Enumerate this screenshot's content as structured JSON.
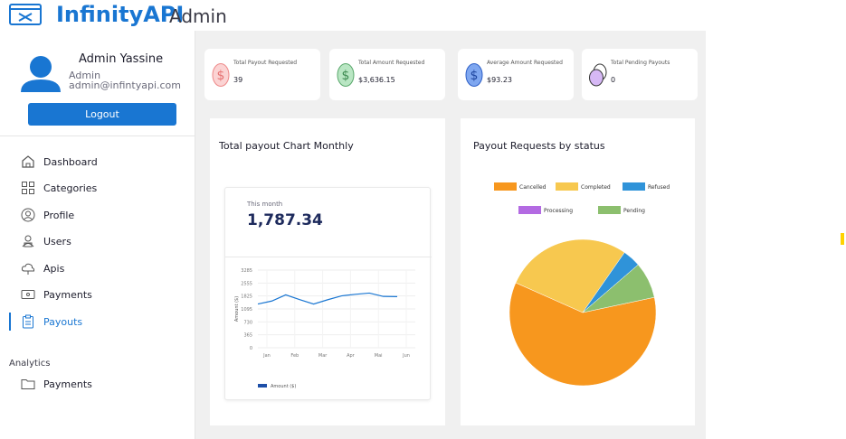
{
  "header": {
    "brand": "InfinityAPI",
    "subtitle": "Admin",
    "brand_color": "#1976d2"
  },
  "profile": {
    "name": "Admin  Yassine",
    "role": "Admin",
    "email": "admin@infintyapi.com",
    "logout_label": "Logout"
  },
  "sidebar": {
    "items": [
      {
        "label": "Dashboard",
        "icon": "home-icon"
      },
      {
        "label": "Categories",
        "icon": "grid-icon"
      },
      {
        "label": "Profile",
        "icon": "person-icon"
      },
      {
        "label": "Users",
        "icon": "users-icon"
      },
      {
        "label": "Apis",
        "icon": "cloud-icon"
      },
      {
        "label": "Payments",
        "icon": "payment-icon"
      },
      {
        "label": "Payouts",
        "icon": "clipboard-icon",
        "active": true
      }
    ],
    "analytics_label": "Analytics",
    "analytics_items": [
      {
        "label": "Payments",
        "icon": "folder-icon"
      }
    ]
  },
  "stats": [
    {
      "label": "Total Payout Requested",
      "value": "39",
      "icon": "dollar-coin-icon",
      "color": "#f4a6a6"
    },
    {
      "label": "Total Amount Requested",
      "value": "$3,636.15",
      "icon": "dollar-coin-icon",
      "color": "#8fd19e"
    },
    {
      "label": "Average Amount Requested",
      "value": "$93.23",
      "icon": "dollar-coin-icon",
      "color": "#5a8bea"
    },
    {
      "label": "Total Pending Payouts",
      "value": "0",
      "icon": "coins-icon",
      "color": "#c9a7f0"
    }
  ],
  "line_panel": {
    "title": "Total payout Chart Monthly",
    "this_month_label": "This month",
    "this_month_value": "1,787.34"
  },
  "pie_panel": {
    "title": "Payout Requests by status"
  },
  "chart_data": [
    {
      "type": "line",
      "title": "Total payout Chart Monthly",
      "ylabel": "Amount ($)",
      "xlabel": "",
      "categories": [
        "Jan",
        "Feb",
        "Mar",
        "Apr",
        "Mai",
        "Jun"
      ],
      "y_ticks": [
        "3285",
        "2555",
        "1825",
        "1095",
        "730",
        "365",
        "0"
      ],
      "series": [
        {
          "name": "Amount ($)",
          "color": "#1976d2",
          "x": [
            0,
            0.5,
            1,
            1.5,
            2,
            2.5,
            3,
            3.5,
            4,
            4.5,
            5
          ],
          "values": [
            1370,
            1540,
            1890,
            1620,
            1370,
            1610,
            1830,
            1920,
            1990,
            1800,
            1790
          ]
        }
      ]
    },
    {
      "type": "pie",
      "title": "Payout Requests by status",
      "categories": [
        "Cancelled",
        "Completed",
        "Refused",
        "Processing",
        "Pending"
      ],
      "values": [
        60,
        28,
        4,
        0,
        8
      ],
      "colors": [
        "#f7971e",
        "#f7c84f",
        "#2f93d9",
        "#b36ae2",
        "#8cbf6e"
      ]
    }
  ]
}
